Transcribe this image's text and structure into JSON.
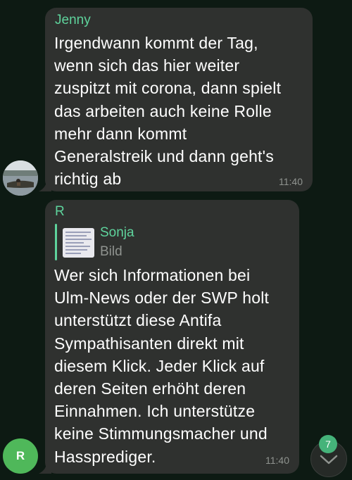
{
  "messages": [
    {
      "sender": "Jenny",
      "text": "Irgendwann kommt der Tag,\nwenn sich das hier weiter\nzuspitzt mit corona, dann spielt\ndas arbeiten auch keine Rolle\nmehr dann kommt\nGeneralstreik und dann geht's\nrichtig ab",
      "time": "11:40"
    },
    {
      "sender": "R",
      "avatar_initial": "R",
      "reply": {
        "sender": "Sonja",
        "type": "Bild"
      },
      "text": "Wer sich Informationen bei\nUlm-News oder der SWP holt\nunterstützt diese Antifa\nSympathisanten direkt mit\ndiesem Klick. Jeder Klick auf\nderen Seiten erhöht deren\nEinnahmen. Ich unterstütze\nkeine Stimmungsmacher und\nHassprediger.",
      "time": "11:40"
    }
  ],
  "scroll_button": {
    "badge": "7",
    "icon": "chevron-down-icon"
  },
  "colors": {
    "background": "#0d1a13",
    "bubble": "#2f312f",
    "sender": "#5ed39c",
    "avatar_r": "#4fb85a",
    "badge": "#45b37a"
  }
}
